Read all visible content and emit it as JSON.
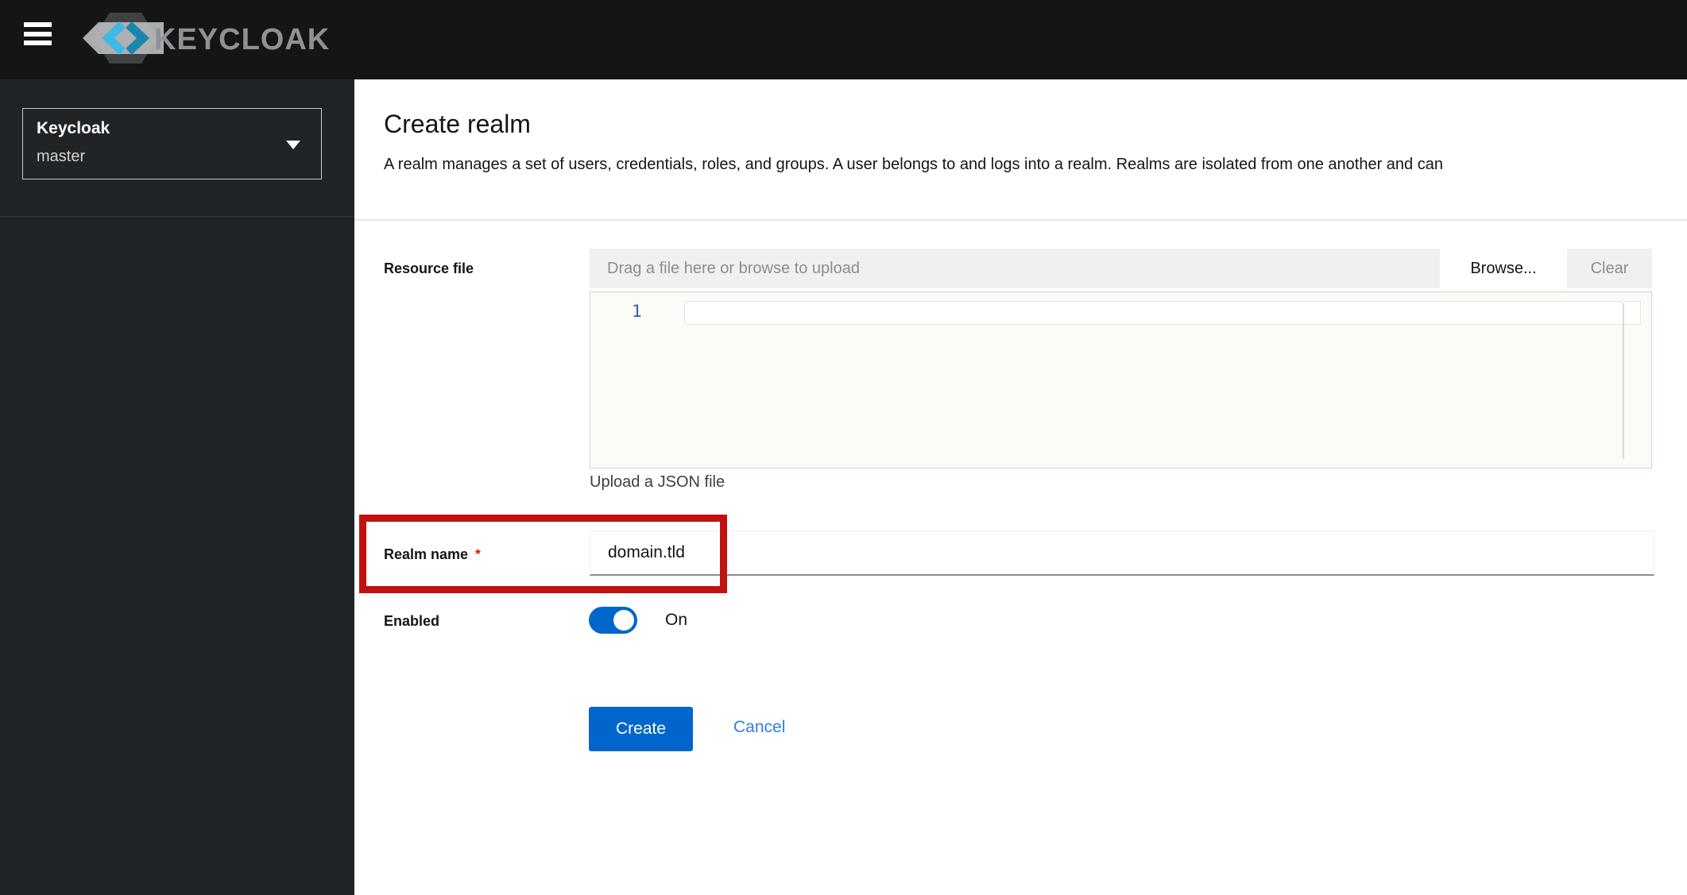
{
  "masthead": {
    "brand_text": "KEYCLOAK"
  },
  "sidebar": {
    "realm_selector": {
      "label": "Keycloak",
      "current_realm": "master"
    }
  },
  "header": {
    "title": "Create realm",
    "description": "A realm manages a set of users, credentials, roles, and groups. A user belongs to and logs into a realm. Realms are isolated from one another and can"
  },
  "form": {
    "resource_file": {
      "label": "Resource file",
      "placeholder": "Drag a file here or browse to upload",
      "browse_button": "Browse...",
      "clear_button": "Clear",
      "editor_line_number": "1",
      "helper_text": "Upload a JSON file"
    },
    "realm_name": {
      "label": "Realm name",
      "required_indicator": "*",
      "value": "domain.tld"
    },
    "enabled": {
      "label": "Enabled",
      "state": "On"
    },
    "actions": {
      "create": "Create",
      "cancel": "Cancel"
    }
  },
  "icons": {
    "menu": "hamburger-icon",
    "brand": "keycloak-logo-icon",
    "realm_selector": "caret-down-icon"
  },
  "annotation": {
    "kind": "red highlight box around Realm name field",
    "color": "#c21111"
  },
  "colors": {
    "primary_blue": "#0066cc",
    "masthead_bg": "#151515",
    "sidebar_bg": "#212427",
    "link_blue": "#3380d6",
    "line_number_blue": "#3b5ca8",
    "annotation_red": "#c21111"
  }
}
